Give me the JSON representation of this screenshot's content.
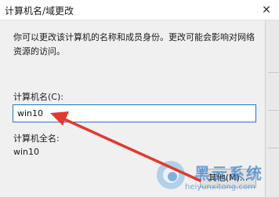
{
  "window": {
    "title": "计算机名/域更改",
    "close_glyph": "✕"
  },
  "dialog": {
    "description": "你可以更改该计算机的名称和成员身份。更改可能会影响对网络资源的访问。",
    "computer_name_label": "计算机名(C):",
    "computer_name_value": "win10",
    "full_name_label": "计算机全名:",
    "full_name_value": "win10",
    "more_button": "其他(M)..."
  },
  "watermark": {
    "brand": "黑云系统",
    "url": "heiyunxitong.com"
  },
  "colors": {
    "arrow": "#e03a2f",
    "input_border": "#2d6fc7",
    "watermark": "#2878c8"
  }
}
